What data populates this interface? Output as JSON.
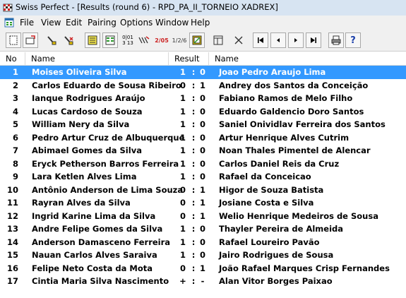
{
  "window": {
    "title": "Swiss Perfect - [Results  (round 6) - RPD_PA_II_TORNEIO XADREX]"
  },
  "menu": [
    "File",
    "View",
    "Edit",
    "Pairing",
    "Options",
    "Window",
    "Help"
  ],
  "toolbar": {
    "icons": [
      "new-file-icon",
      "open-file-icon",
      "edit-player-icon",
      "delete-player-icon",
      "notes-icon",
      "sheet-icon",
      "pairing-numbers-icon",
      "ratings-icon",
      "scores-icon",
      "rankings-icon",
      "crosstable-icon",
      "columns-icon",
      "close-x-icon",
      "first-icon",
      "previous-icon",
      "next-icon",
      "last-icon",
      "print-icon",
      "help-icon"
    ],
    "labels": {
      "pairing_numbers": "0|01\n3 13",
      "scores": "2/05",
      "rankings": "1/2/6"
    }
  },
  "table": {
    "columns": {
      "no": "No",
      "white": "Name",
      "result": "Result",
      "black": "Name"
    },
    "rows": [
      {
        "no": "1",
        "white": "Moises Oliveira Silva",
        "r1": "1",
        "sep": ":",
        "r2": "0",
        "black": "Joao Pedro Araujo Lima",
        "selected": true
      },
      {
        "no": "2",
        "white": "Carlos Eduardo de Sousa Ribeiro",
        "r1": "0",
        "sep": ":",
        "r2": "1",
        "black": "Andrey dos Santos da Conceição"
      },
      {
        "no": "3",
        "white": "Ianque Rodrigues Araújo",
        "r1": "1",
        "sep": ":",
        "r2": "0",
        "black": "Fabiano Ramos de Melo Filho"
      },
      {
        "no": "4",
        "white": "Lucas Cardoso de Souza",
        "r1": "1",
        "sep": ":",
        "r2": "0",
        "black": "Eduardo Galdencio Doro Santos"
      },
      {
        "no": "5",
        "white": "William Nery da Silva",
        "r1": "1",
        "sep": ":",
        "r2": "0",
        "black": "Saniel Onividlav Ferreira dos Santos"
      },
      {
        "no": "6",
        "white": "Pedro Artur Cruz de Albuquerque",
        "r1": "1",
        "sep": ":",
        "r2": "0",
        "black": "Artur Henrique Alves Cutrim"
      },
      {
        "no": "7",
        "white": "Abimael Gomes da Silva",
        "r1": "1",
        "sep": ":",
        "r2": "0",
        "black": "Noan Thales Pimentel de Alencar"
      },
      {
        "no": "8",
        "white": "Eryck Petherson Barros Ferreira",
        "r1": "1",
        "sep": ":",
        "r2": "0",
        "black": "Carlos Daniel Reis da Cruz"
      },
      {
        "no": "9",
        "white": "Lara Ketlen Alves Lima",
        "r1": "1",
        "sep": ":",
        "r2": "0",
        "black": "Rafael da Conceicao"
      },
      {
        "no": "10",
        "white": "Antônio Anderson de Lima Souza",
        "r1": "0",
        "sep": ":",
        "r2": "1",
        "black": "Higor de Souza Batista"
      },
      {
        "no": "11",
        "white": "Rayran Alves da Silva",
        "r1": "0",
        "sep": ":",
        "r2": "1",
        "black": "Josiane Costa e Silva"
      },
      {
        "no": "12",
        "white": "Ingrid Karine Lima da Silva",
        "r1": "0",
        "sep": ":",
        "r2": "1",
        "black": "Welio Henrique Medeiros de Sousa"
      },
      {
        "no": "13",
        "white": "Andre Felipe Gomes da Silva",
        "r1": "1",
        "sep": ":",
        "r2": "0",
        "black": "Thayler Pereira de Almeida"
      },
      {
        "no": "14",
        "white": "Anderson Damasceno Ferreira",
        "r1": "1",
        "sep": ":",
        "r2": "0",
        "black": "Rafael Loureiro Pavão"
      },
      {
        "no": "15",
        "white": "Nauan Carlos Alves Saraiva",
        "r1": "1",
        "sep": ":",
        "r2": "0",
        "black": "Jairo Rodrigues de Sousa"
      },
      {
        "no": "16",
        "white": "Felipe Neto Costa da Mota",
        "r1": "0",
        "sep": ":",
        "r2": "1",
        "black": "João Rafael Marques Crisp Fernandes"
      },
      {
        "no": "17",
        "white": "Cintia Maria Silva Nascimento",
        "r1": "+",
        "sep": ":",
        "r2": "-",
        "black": "Alan Vitor Borges Paixao"
      }
    ]
  },
  "colors": {
    "selection": "#3399ff",
    "titlebar": "#d7e4f2",
    "chrome": "#f0f0f0"
  }
}
